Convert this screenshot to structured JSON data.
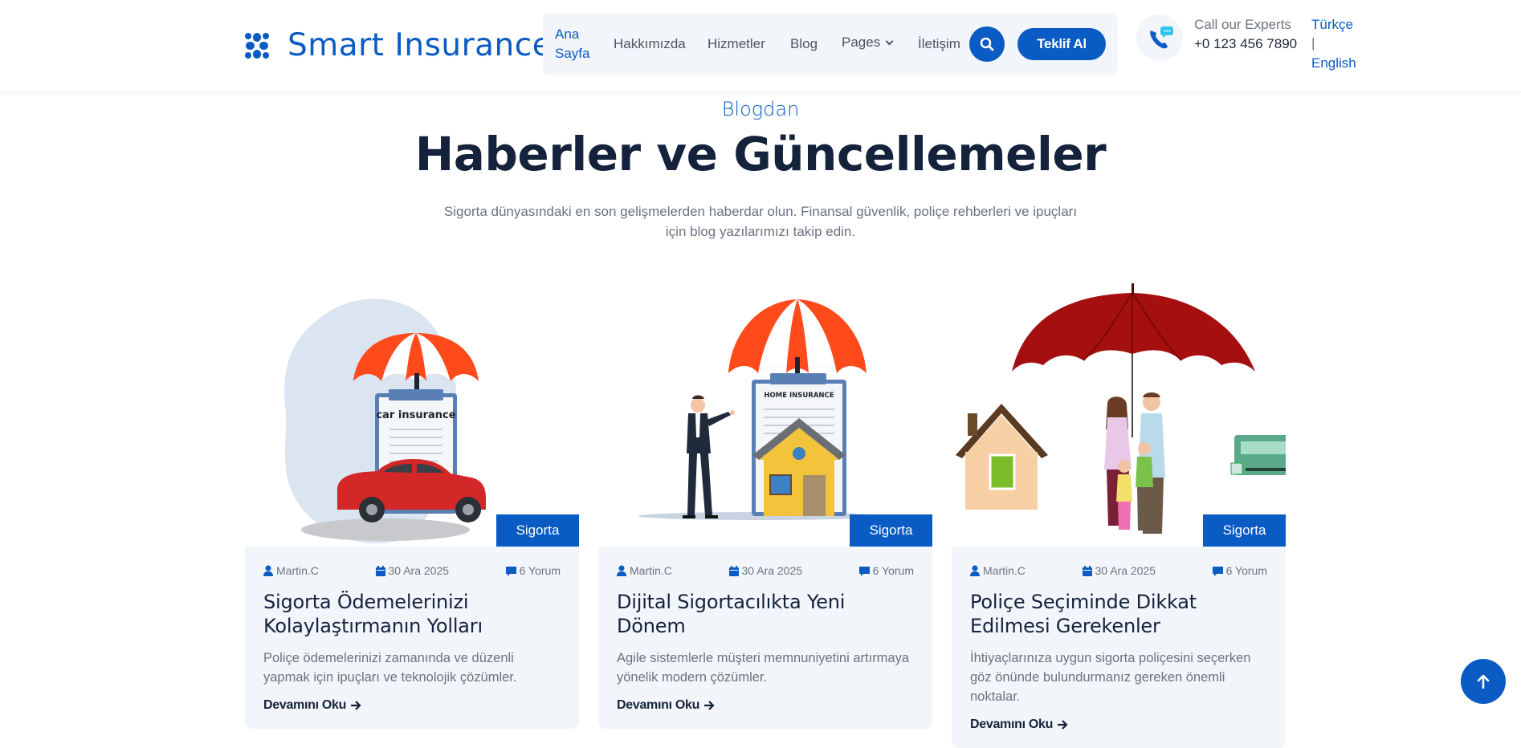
{
  "brand": {
    "name": "Smart Insurance",
    "accent": "#0a5bc4"
  },
  "nav": {
    "items": [
      {
        "label_line1": "Ana",
        "label_line2": "Sayfa"
      },
      {
        "label": "Hakkımızda"
      },
      {
        "label": "Hizmetler"
      },
      {
        "label": "Blog"
      },
      {
        "label": "Pages"
      },
      {
        "label": "İletişim"
      }
    ],
    "search_icon": "search-icon",
    "cta_label": "Teklif Al"
  },
  "contact": {
    "label": "Call our Experts",
    "phone": "+0 123 456 7890",
    "icon": "phone-chat-icon"
  },
  "languages": {
    "tr": "Türkçe",
    "separator": "|",
    "en": "English"
  },
  "section": {
    "eyebrow": "Blogdan",
    "title": "Haberler ve Güncellemeler",
    "subtitle": "Sigorta dünyasındaki en son gelişmelerden haberdar olun. Finansal güvenlik, poliçe rehberleri ve ipuçları için blog yazılarımızı takip edin."
  },
  "posts": [
    {
      "tag": "Sigorta",
      "image_caption": "car insurance",
      "author": "Martin.C",
      "date": "30 Ara 2025",
      "comments": "6 Yorum",
      "title": "Sigorta Ödemelerinizi Kolaylaştırmanın Yolları",
      "excerpt": "Poliçe ödemelerinizi zamanında ve düzenli yapmak için ipuçları ve teknolojik çözümler.",
      "link": "Devamını Oku"
    },
    {
      "tag": "Sigorta",
      "image_caption": "HOME INSURANCE",
      "author": "Martin.C",
      "date": "30 Ara 2025",
      "comments": "6 Yorum",
      "title": "Dijital Sigortacılıkta Yeni Dönem",
      "excerpt": "Agile sistemlerle müşteri memnuniyetini artırmaya yönelik modern çözümler.",
      "link": "Devamını Oku"
    },
    {
      "tag": "Sigorta",
      "author": "Martin.C",
      "date": "30 Ara 2025",
      "comments": "6 Yorum",
      "title": "Poliçe Seçiminde Dikkat Edilmesi Gerekenler",
      "excerpt": "İhtiyaçlarınıza uygun sigorta poliçesini seçerken göz önünde bulundurmanız gereken önemli noktalar.",
      "link": "Devamını Oku"
    }
  ],
  "scroll_top_icon": "arrow-up-icon"
}
